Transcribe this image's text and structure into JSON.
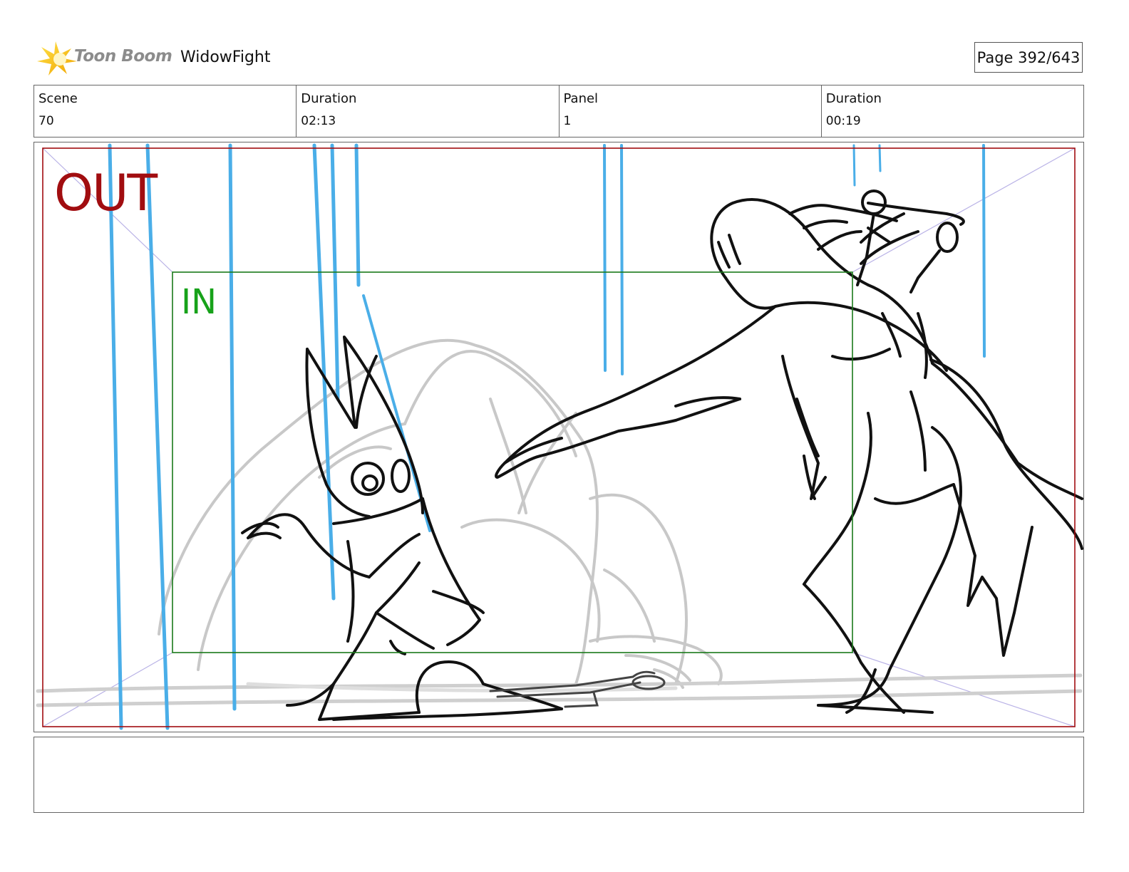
{
  "header": {
    "logo_icon": "toon-boom-star-icon",
    "brand": "Toon Boom",
    "project_title": "WidowFight",
    "page_indicator": "Page 392/643"
  },
  "info": {
    "scene_label": "Scene",
    "scene_value": "70",
    "scene_duration_label": "Duration",
    "scene_duration_value": "02:13",
    "panel_label": "Panel",
    "panel_value": "1",
    "panel_duration_label": "Duration",
    "panel_duration_value": "00:19"
  },
  "panel": {
    "out_label": "OUT",
    "in_label": "IN",
    "colors": {
      "out_frame": "#a10d10",
      "in_frame": "#1a7a1a",
      "rain": "#4aaee8",
      "sketch": "#111111",
      "background_sketch": "#c8c8c8"
    }
  },
  "notes": {
    "text": ""
  }
}
